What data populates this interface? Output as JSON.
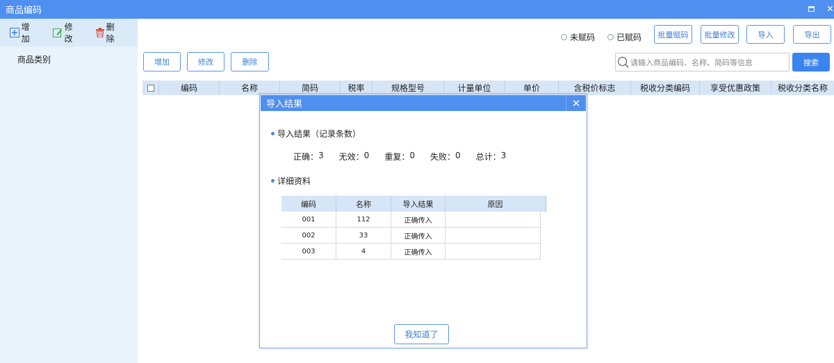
{
  "window": {
    "title": "商品编码"
  },
  "sidebar": {
    "toolbar": {
      "add_label": "增加",
      "edit_label": "修改",
      "delete_label": "删除"
    },
    "category_label": "商品类别"
  },
  "filters": {
    "uncoded_label": "未赋码",
    "coded_label": "已赋码"
  },
  "toolbar": {
    "batch_code_label": "批量赋码",
    "batch_edit_label": "批量修改",
    "import_label": "导入",
    "export_label": "导出",
    "add_label": "增加",
    "edit_label": "修改",
    "delete_label": "删除"
  },
  "search": {
    "placeholder": "请输入商品编码、名称、简码等信息",
    "button_label": "搜索"
  },
  "table": {
    "columns": [
      "编码",
      "名称",
      "简码",
      "税率",
      "规格型号",
      "计量单位",
      "单价",
      "含税价标志",
      "税收分类编码",
      "享受优惠政策",
      "税收分类名称"
    ]
  },
  "dialog": {
    "title": "导入结果",
    "section1_title": "导入结果（记录条数）",
    "stats": [
      {
        "label": "正确：",
        "value": "3"
      },
      {
        "label": "无效：",
        "value": "0"
      },
      {
        "label": "重复：",
        "value": "0"
      },
      {
        "label": "失败：",
        "value": "0"
      },
      {
        "label": "总计：",
        "value": "3"
      }
    ],
    "section2_title": "详细资料",
    "detail_columns": [
      "编码",
      "名称",
      "导入结果",
      "原因"
    ],
    "detail_rows": [
      {
        "code": "001",
        "name": "112",
        "result": "正确传入",
        "reason": ""
      },
      {
        "code": "002",
        "name": "33",
        "result": "正确传入",
        "reason": ""
      },
      {
        "code": "003",
        "name": "4",
        "result": "正确传入",
        "reason": ""
      }
    ],
    "ok_label": "我知道了"
  },
  "colors": {
    "titlebar": "#4f8ff0",
    "accent": "#3a84f0",
    "sidebar": "#e9f3fc",
    "header_row": "#d7e6f7"
  }
}
